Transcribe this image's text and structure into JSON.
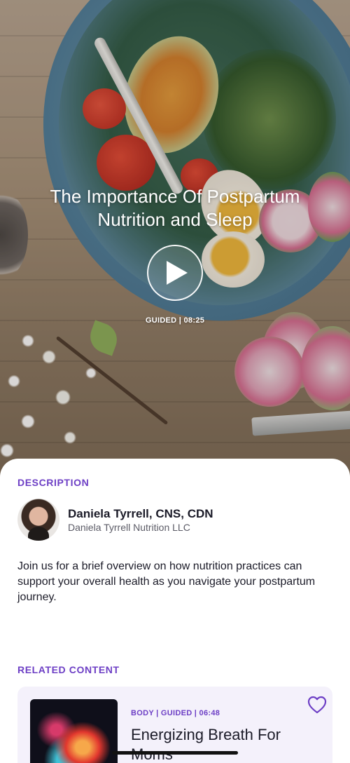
{
  "hero": {
    "title": "The Importance Of Postpartum Nutrition and Sleep",
    "meta": "GUIDED | 08:25"
  },
  "description": {
    "label": "DESCRIPTION",
    "author_name": "Daniela Tyrrell, CNS, CDN",
    "author_org": "Daniela Tyrrell Nutrition LLC",
    "text": "Join us for a brief overview on how nutrition practices can support your overall health as you navigate your postpartum journey."
  },
  "related": {
    "label": "RELATED CONTENT",
    "items": [
      {
        "meta": "BODY | GUIDED | 06:48",
        "title": "Energizing Breath For Moms"
      }
    ]
  },
  "colors": {
    "accent": "#6d3fc5",
    "card_background": "#f4f1fb",
    "text_primary": "#1b1b28"
  },
  "icons": [
    "play-icon",
    "heart-outline-icon"
  ]
}
